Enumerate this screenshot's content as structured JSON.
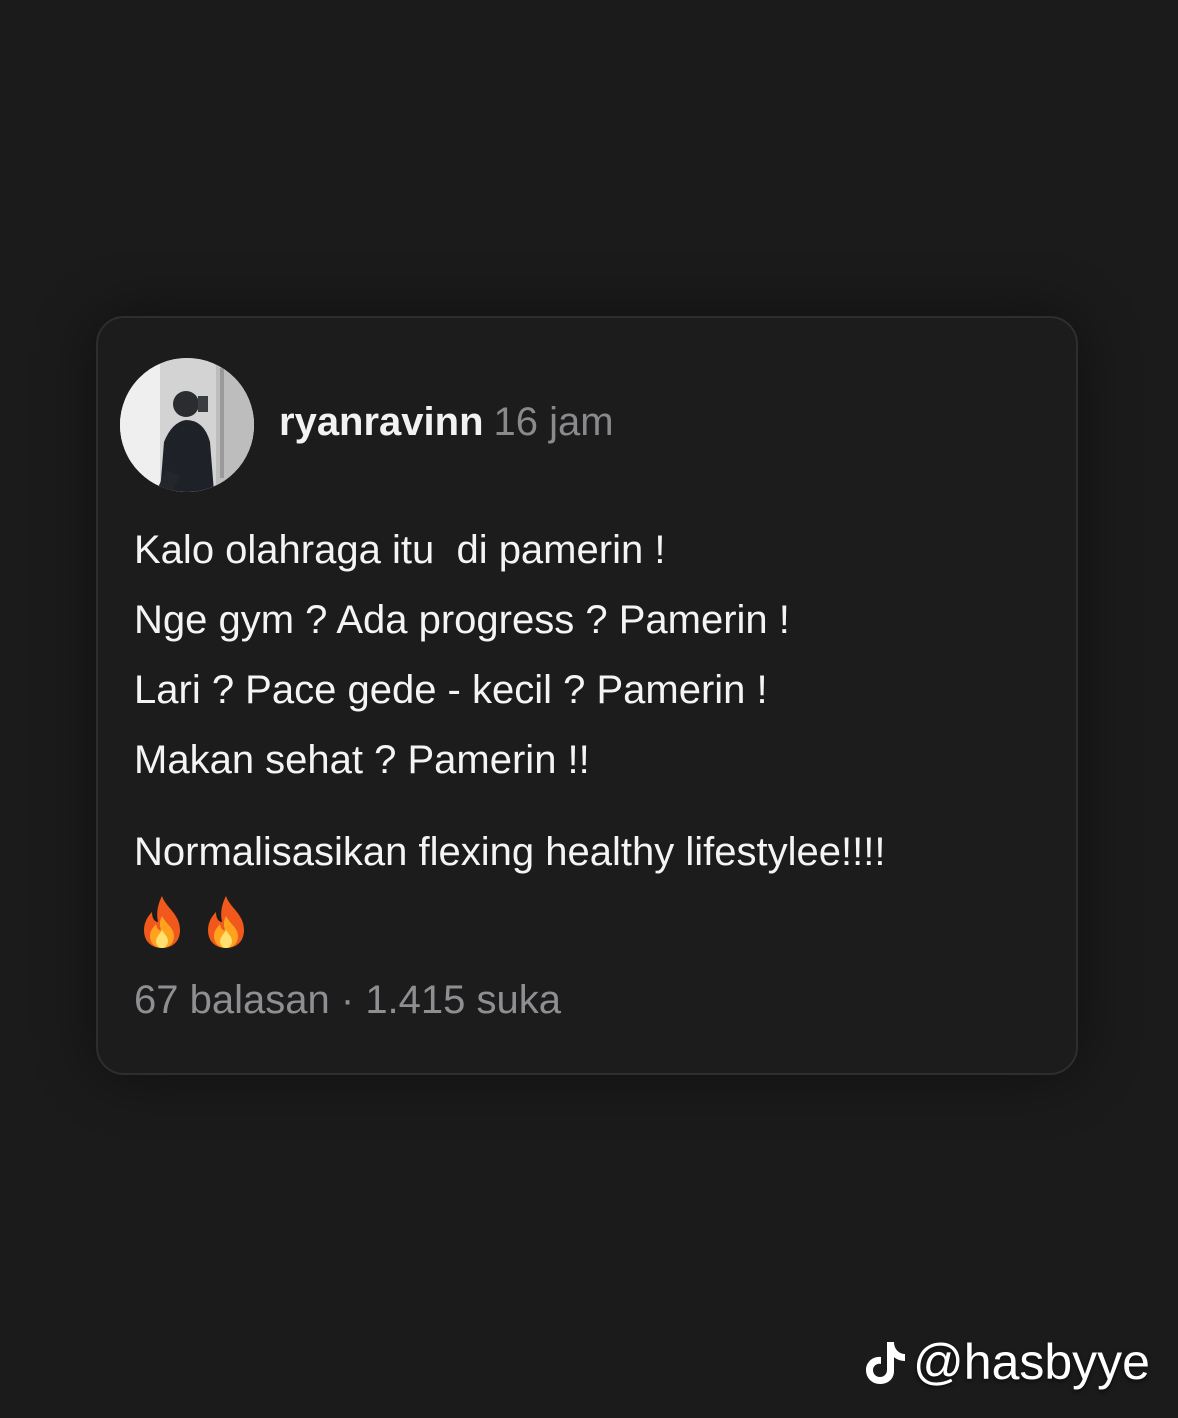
{
  "post": {
    "username": "ryanravinn",
    "time": "16 jam",
    "lines": [
      "Kalo olahraga itu  di pamerin !",
      "Nge gym ? Ada progress ? Pamerin !",
      "Lari ? Pace gede - kecil ? Pamerin !",
      "Makan sehat ? Pamerin !!"
    ],
    "closing": "Normalisasikan flexing healthy lifestylee!!!!",
    "emojis": [
      "fire-icon",
      "fire-icon"
    ],
    "replies": "67 balasan",
    "separator": "·",
    "likes": "1.415 suka"
  },
  "watermark": {
    "handle": "@hasbyye",
    "icon": "tiktok-icon"
  }
}
